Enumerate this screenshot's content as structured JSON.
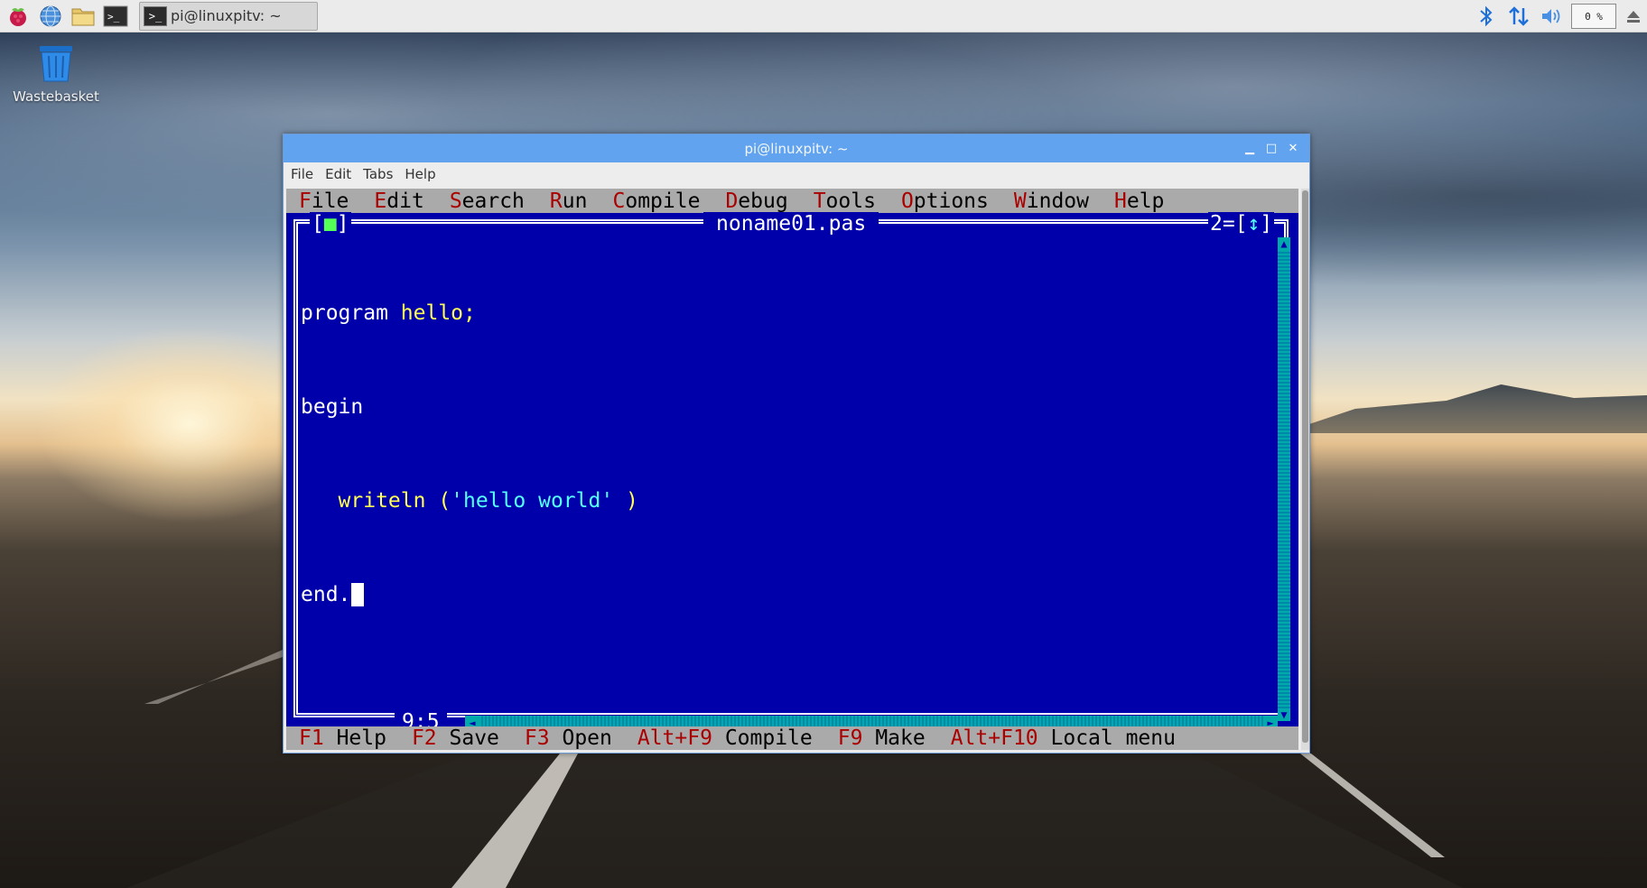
{
  "taskbar": {
    "launchers": [
      "raspberry-menu-icon",
      "web-browser-icon",
      "file-manager-icon",
      "terminal-icon"
    ],
    "task_label": "pi@linuxpitv: ~",
    "cpu_label": "0 %"
  },
  "desktop": {
    "wastebasket_label": "Wastebasket"
  },
  "window": {
    "title": "pi@linuxpitv: ~",
    "menu": [
      "File",
      "Edit",
      "Tabs",
      "Help"
    ]
  },
  "ide": {
    "menu": [
      {
        "hotkey": "F",
        "rest": "ile"
      },
      {
        "hotkey": "E",
        "rest": "dit"
      },
      {
        "hotkey": "S",
        "rest": "earch"
      },
      {
        "hotkey": "R",
        "rest": "un"
      },
      {
        "hotkey": "C",
        "rest": "ompile"
      },
      {
        "hotkey": "D",
        "rest": "ebug"
      },
      {
        "hotkey": "T",
        "rest": "ools"
      },
      {
        "hotkey": "O",
        "rest": "ptions"
      },
      {
        "hotkey": "W",
        "rest": "indow"
      },
      {
        "hotkey": "H",
        "rest": "elp"
      }
    ],
    "editor": {
      "close_box_left": "[",
      "close_box_mark": "■",
      "close_box_right": "]",
      "filename": "noname01.pas",
      "window_number": "2=[",
      "zoom_mark": "↕",
      "zoom_right": "]",
      "cursor_pos": "9:5",
      "code": {
        "l1_kw": "program ",
        "l1_id": "hello;",
        "l2_kw": "begin",
        "l3_indent": "   ",
        "l3_id": "writeln (",
        "l3_str": "'hello world'",
        "l3_end": " )",
        "l4_kw": "end."
      }
    },
    "status": [
      {
        "key": "F1",
        "label": "Help"
      },
      {
        "key": "F2",
        "label": "Save"
      },
      {
        "key": "F3",
        "label": "Open"
      },
      {
        "key": "Alt+F9",
        "label": "Compile"
      },
      {
        "key": "F9",
        "label": "Make"
      },
      {
        "key": "Alt+F10",
        "label": "Local menu"
      }
    ]
  }
}
